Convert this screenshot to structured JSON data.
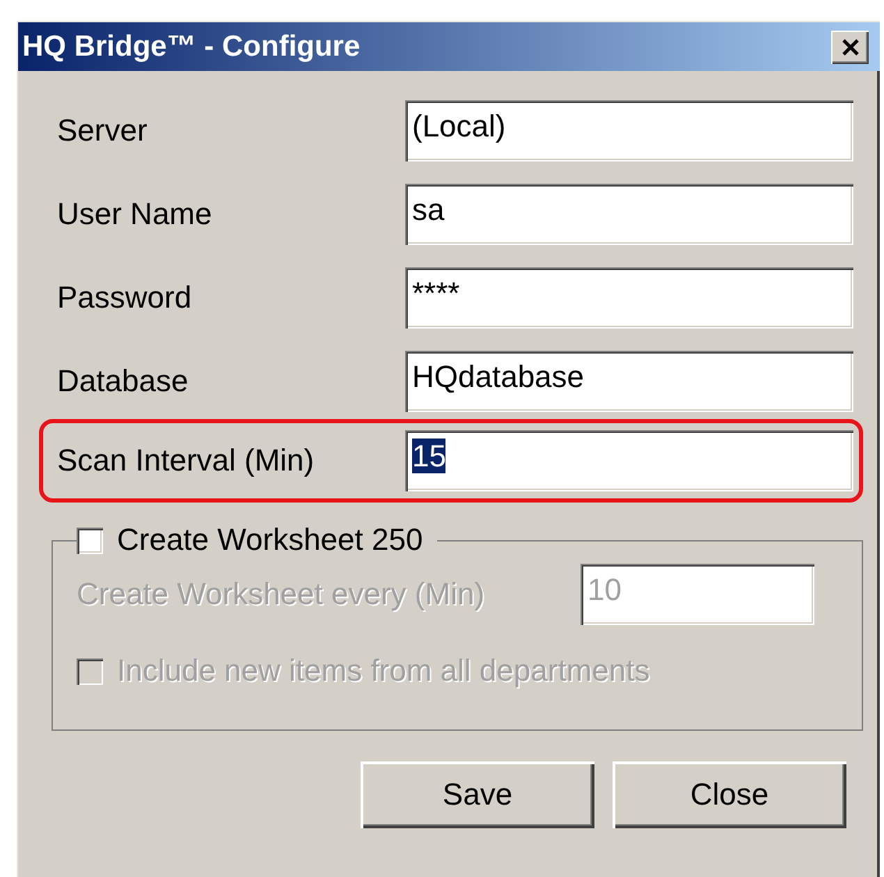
{
  "window": {
    "title": "HQ Bridge™ - Configure"
  },
  "fields": [
    {
      "label": "Server",
      "value": "(Local)",
      "highlighted": false,
      "value_selected": false
    },
    {
      "label": "User Name",
      "value": "sa",
      "highlighted": false,
      "value_selected": false
    },
    {
      "label": "Password",
      "value": "****",
      "highlighted": false,
      "value_selected": false
    },
    {
      "label": "Database",
      "value": "HQdatabase",
      "highlighted": false,
      "value_selected": false
    },
    {
      "label": "Scan Interval (Min)",
      "value": "15",
      "highlighted": true,
      "value_selected": true
    }
  ],
  "worksheet_group": {
    "checkbox": {
      "label": "Create Worksheet 250",
      "checked": false,
      "disabled": false
    },
    "interval": {
      "label": "Create Worksheet every (Min)",
      "value": "10",
      "disabled": true
    },
    "include_checkbox": {
      "label": "Include new items from all departments",
      "checked": false,
      "disabled": true
    }
  },
  "buttons": [
    {
      "label": "Save"
    },
    {
      "label": "Close"
    }
  ]
}
